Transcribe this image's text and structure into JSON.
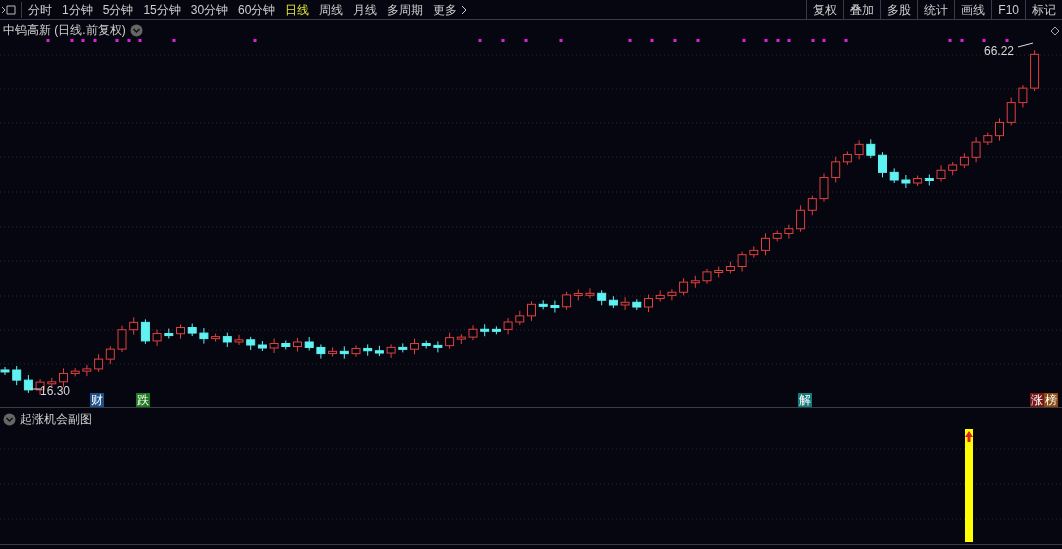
{
  "toolbar": {
    "periods": [
      {
        "label": "分时",
        "selected": false
      },
      {
        "label": "1分钟",
        "selected": false
      },
      {
        "label": "5分钟",
        "selected": false
      },
      {
        "label": "15分钟",
        "selected": false
      },
      {
        "label": "30分钟",
        "selected": false
      },
      {
        "label": "60分钟",
        "selected": false
      },
      {
        "label": "日线",
        "selected": true
      },
      {
        "label": "周线",
        "selected": false
      },
      {
        "label": "月线",
        "selected": false
      },
      {
        "label": "多周期",
        "selected": false
      },
      {
        "label": "更多",
        "selected": false
      }
    ],
    "buttons": [
      "复权",
      "叠加",
      "多股",
      "统计",
      "画线",
      "F10",
      "标记"
    ]
  },
  "chart": {
    "title": "中钨高新 (日线.前复权)",
    "low_label": "16.30",
    "high_label": "66.22",
    "markers": [
      {
        "text": "财",
        "color": "#1c4f86"
      },
      {
        "text": "跌",
        "color": "#1f7a1f"
      },
      {
        "text": "解",
        "color": "#127c78"
      },
      {
        "text": "涨",
        "color": "#761818"
      },
      {
        "text": "榜",
        "color": "#8a4c12"
      }
    ]
  },
  "sub_panel": {
    "title": "起涨机会副图"
  }
}
